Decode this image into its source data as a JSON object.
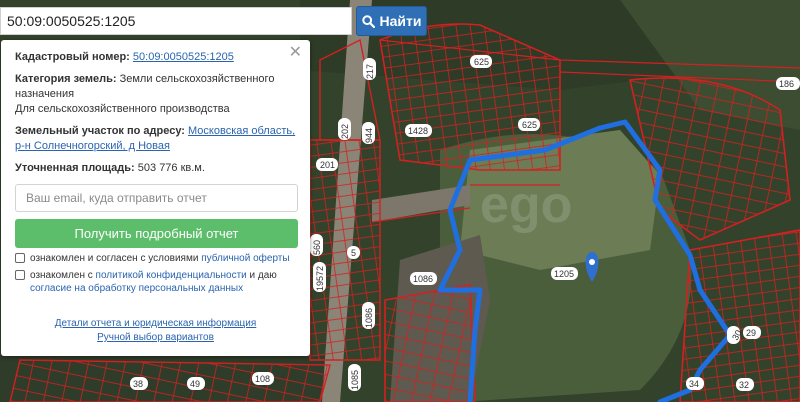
{
  "search": {
    "value": "50:09:0050525:1205",
    "button_label": "Найти"
  },
  "info": {
    "cadastral_label": "Кадастровый номер:",
    "cadastral_value": "50:09:0050525:1205",
    "category_label": "Категория земель:",
    "category_value": "Земли сельскохозяйственного назначения",
    "category_use": "Для сельскохозяйственного производства",
    "address_label": "Земельный участок по адресу:",
    "address_value": "Московская область, р-н Солнечногорский, д Новая",
    "area_label": "Уточненная площадь:",
    "area_value": "503 776 кв.м."
  },
  "form": {
    "email_placeholder": "Ваш email, куда отправить отчет",
    "submit_label": "Получить подробный отчет",
    "consent1_text": "ознакомлен и согласен с условиями ",
    "consent1_link": "публичной оферты",
    "consent2_text": "ознакомлен с ",
    "consent2_link1": "политикой конфиденциальности",
    "consent2_mid": " и даю ",
    "consent2_link2": "согласие на обработку персональных данных"
  },
  "links": {
    "details": "Детали отчета и юридическая информация",
    "manual": "Ручной выбор вариантов"
  },
  "map": {
    "parcel_numbers": [
      "625",
      "625",
      "1428",
      "217",
      "944",
      "202",
      "201",
      "560",
      "19572",
      "5",
      "1086",
      "1086",
      "1085",
      "1205",
      "186",
      "38",
      "49",
      "108",
      "30",
      "29",
      "34",
      "32"
    ],
    "watermark": "ego",
    "colors": {
      "border": "#d42020",
      "selected": "#1f6fe0",
      "pin": "#2f6fd0"
    }
  }
}
